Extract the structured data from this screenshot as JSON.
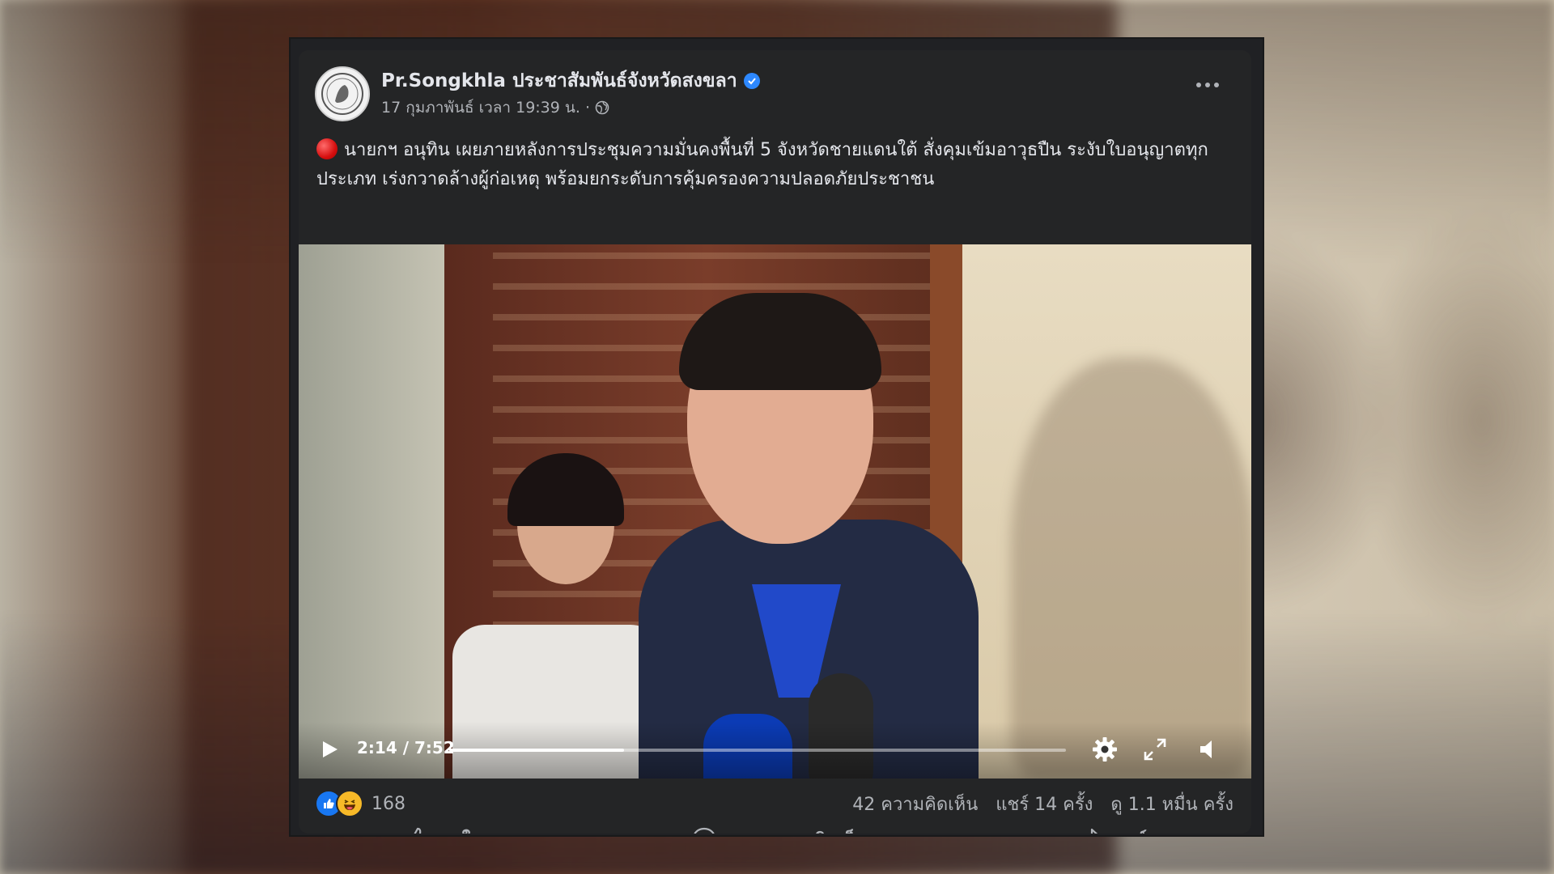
{
  "post": {
    "page_name": "Pr.Songkhla ประชาสัมพันธ์จังหวัดสงขลา",
    "timestamp": "17 กุมภาพันธ์ เวลา 19:39 น.",
    "separator": "·",
    "text": "นายกฯ อนุทิน เผยภายหลังการประชุมความมั่นคงพื้นที่ 5 จังหวัดชายแดนใต้ สั่งคุมเข้มอาวุธปืน ระงับใบอนุญาตทุกประเภท เร่งกวาดล้างผู้ก่อเหตุ พร้อมยกระดับการคุ้มครองความปลอดภัยประชาชน"
  },
  "video": {
    "current_time": "2:14",
    "duration": "7:52",
    "time_display": "2:14 / 7:52",
    "progress": 0.284
  },
  "stats": {
    "reaction_count": "168",
    "comments": "42 ความคิดเห็น",
    "shares": "แชร์ 14 ครั้ง",
    "views": "ดู 1.1 หมื่น ครั้ง"
  },
  "actions": {
    "like": "ถูกใจ",
    "comment": "แสดงความคิดเห็น",
    "share": "แชร์"
  },
  "colors": {
    "card_bg": "#242526",
    "text_primary": "#e4e6eb",
    "text_secondary": "#b0b3b8",
    "verified_blue": "#2d88ff",
    "like_blue": "#1877f2"
  },
  "icons": [
    "verified-icon",
    "globe-icon",
    "more-options-icon",
    "play-icon",
    "settings-icon",
    "fullscreen-icon",
    "volume-icon",
    "like-reaction-icon",
    "haha-reaction-icon",
    "thumbs-up-icon",
    "comment-icon",
    "share-icon"
  ]
}
